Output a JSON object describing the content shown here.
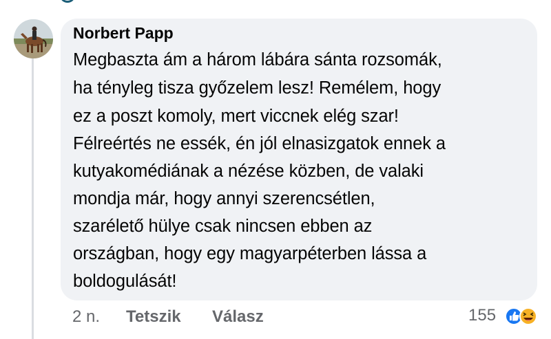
{
  "comment": {
    "author": "Norbert Papp",
    "lines": [
      "Megbaszta ám a három lábára sánta rozsomák,",
      "ha tényleg tisza győzelem lesz! Remélem, hogy",
      "ez a poszt komoly, mert viccnek elég szar!",
      "Félreértés ne essék, én jól elnasizgatok ennek a",
      "kutyakomédiának a nézése közben, de valaki",
      "mondja már, hogy annyi szerencsétlen,",
      "szarélető hülye csak nincsen ebben az",
      "országban, hogy egy magyarpéterben lássa a",
      "boldogulását!"
    ]
  },
  "actions": {
    "time": "2 n.",
    "like_label": "Tetszik",
    "reply_label": "Válasz"
  },
  "reactions": {
    "count": "155",
    "icons": [
      "like-reaction-icon",
      "haha-reaction-icon"
    ]
  },
  "colors": {
    "bubble": "#f0f2f5",
    "text": "#050505",
    "secondary": "#65676b",
    "like_blue": "#1877f2",
    "haha_yellow": "#f7b125"
  }
}
